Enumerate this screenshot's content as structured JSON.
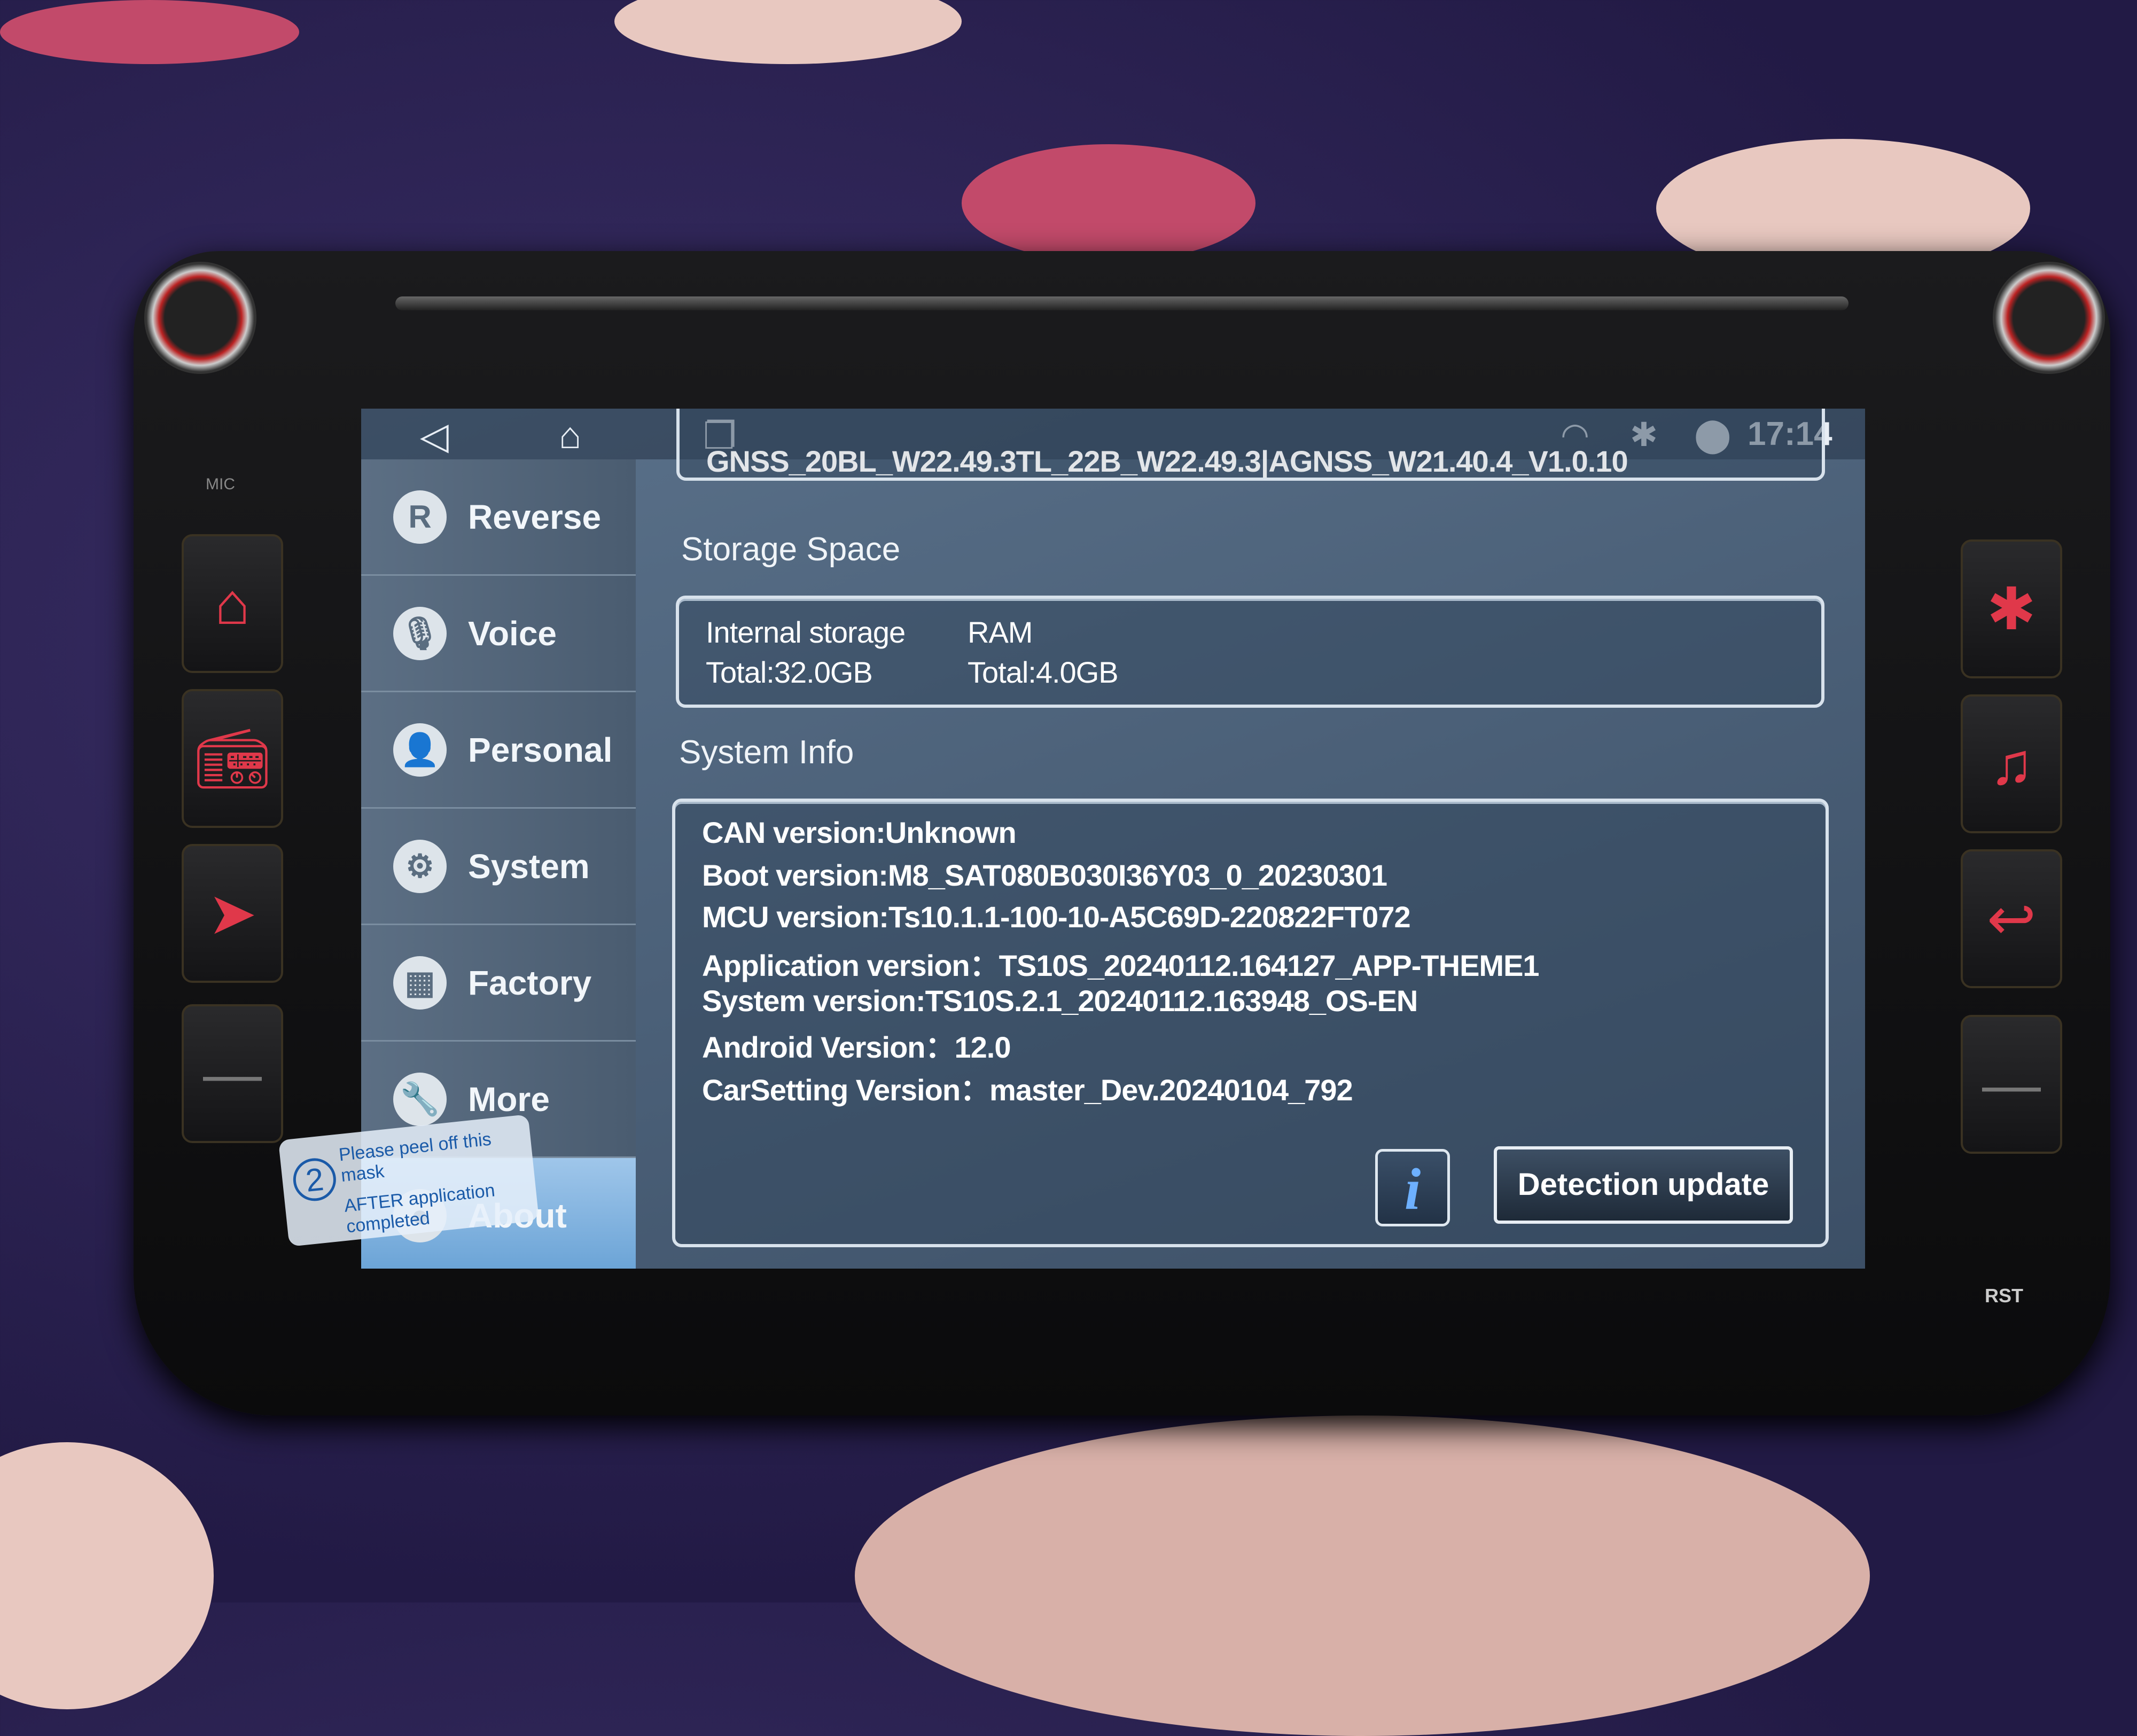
{
  "navbar": {
    "back_icon": "back-triangle-icon",
    "home_icon": "home-icon",
    "recents_icon": "recents-icon"
  },
  "status": {
    "time": "17:14",
    "icons": [
      "wifi-icon",
      "bluetooth-icon",
      "location-icon"
    ]
  },
  "sidebar": {
    "items": [
      {
        "label": "Reverse",
        "icon": "R"
      },
      {
        "label": "Voice",
        "icon": "🎙"
      },
      {
        "label": "Personal",
        "icon": "👤"
      },
      {
        "label": "System",
        "icon": "⚙"
      },
      {
        "label": "Factory",
        "icon": "▦"
      },
      {
        "label": "More",
        "icon": "🔧"
      },
      {
        "label": "About",
        "icon": "●",
        "selected": true
      }
    ]
  },
  "main": {
    "truncated_line": "GNSS_20BL_W22.49.3TL_22B_W22.49.3|AGNSS_W21.40.4_V1.0.10",
    "storage": {
      "heading": "Storage Space",
      "internal_label": "Internal storage",
      "internal_total": "Total:32.0GB",
      "ram_label": "RAM",
      "ram_total": "Total:4.0GB"
    },
    "system_info": {
      "heading": "System Info",
      "lines": [
        "CAN version:Unknown",
        "Boot version:M8_SAT080B030I36Y03_0_20230301",
        "MCU version:Ts10.1.1-100-10-A5C69D-220822FT072",
        "Application version：TS10S_20240112.164127_APP-THEME1",
        "System version:TS10S.2.1_20240112.163948_OS-EN",
        "Android Version：12.0",
        "CarSetting Version：master_Dev.20240104_792"
      ]
    },
    "info_button": "i",
    "detection_button": "Detection update"
  },
  "sticker": {
    "number": "2",
    "line1": "Please peel off this mask",
    "line2": "AFTER application completed"
  },
  "hardware": {
    "left_buttons": [
      "home-icon",
      "radio-icon",
      "navigation-icon",
      "minus-icon"
    ],
    "right_buttons": [
      "bluetooth-icon",
      "music-icon",
      "back-icon",
      "minus-icon"
    ],
    "labels": {
      "mic": "MIC",
      "rst": "RST"
    }
  },
  "colors": {
    "accent_red": "#e0384a",
    "selected_item": "#8ab8e4",
    "screen_bg": "#4c6178"
  }
}
